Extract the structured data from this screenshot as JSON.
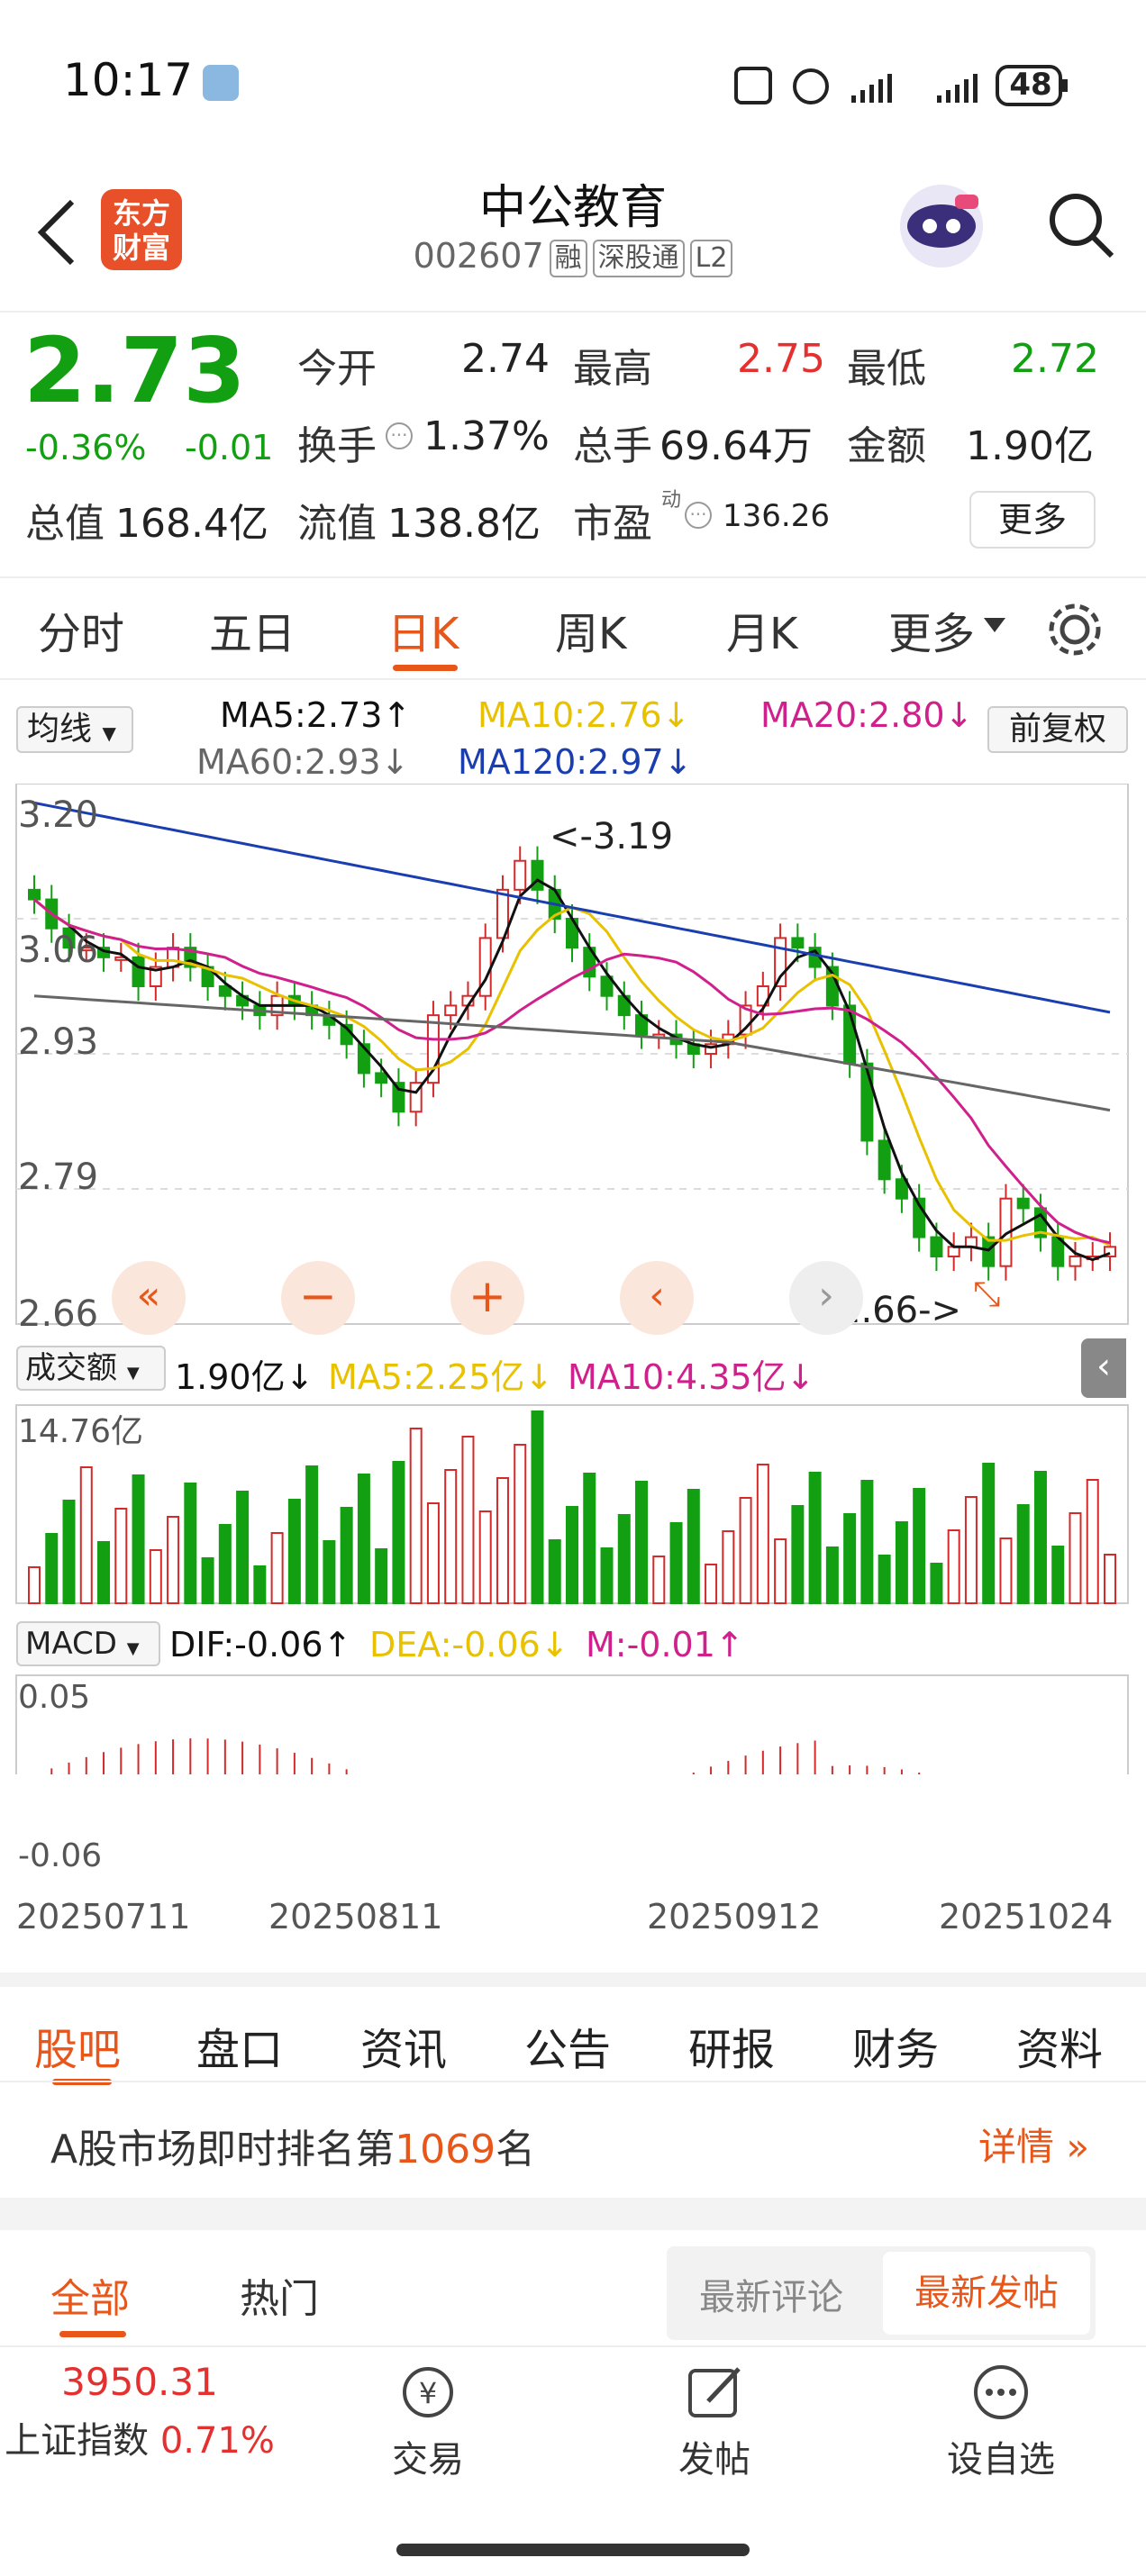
{
  "status_bar": {
    "time": "10:17",
    "battery": "48"
  },
  "header": {
    "title": "中公教育",
    "code": "002607",
    "tags": [
      "融",
      "深股通",
      "L2"
    ],
    "logo_text": [
      "东方",
      "财富"
    ]
  },
  "quote": {
    "price": "2.73",
    "change_pct": "-0.36%",
    "change": "-0.01",
    "open_label": "今开",
    "open": "2.74",
    "high_label": "最高",
    "high": "2.75",
    "low_label": "最低",
    "low": "2.72",
    "turnover_label": "换手",
    "turnover": "1.37%",
    "volume_label": "总手",
    "volume": "69.64万",
    "amount_label": "金额",
    "amount": "1.90亿",
    "total_cap_label": "总值",
    "total_cap": "168.4亿",
    "float_cap_label": "流值",
    "float_cap": "138.8亿",
    "pe_label": "市盈",
    "pe_sup": "动",
    "pe": "136.26",
    "more_button": "更多"
  },
  "tabs": [
    "分时",
    "五日",
    "日K",
    "周K",
    "月K",
    "更多"
  ],
  "active_tab": 2,
  "indicators": {
    "ma_select": "均线",
    "ma5": "MA5:2.73↑",
    "ma10": "MA10:2.76↓",
    "ma20": "MA20:2.80↓",
    "ma60": "MA60:2.93↓",
    "ma120": "MA120:2.97↓",
    "adjust": "前复权",
    "vol_select": "成交额",
    "vol": "1.90亿↓",
    "vol_ma5": "MA5:2.25亿↓",
    "vol_ma10": "MA10:4.35亿↓",
    "macd_select": "MACD",
    "dif": "DIF:-0.06↑",
    "dea": "DEA:-0.06↓",
    "m": "M:-0.01↑"
  },
  "chart_data": {
    "type": "candlestick",
    "y_labels": [
      "3.20",
      "3.06",
      "2.93",
      "2.79",
      "2.66"
    ],
    "ylim": [
      2.65,
      3.21
    ],
    "high_marker": "<-3.19",
    "low_marker": "2.66->",
    "vol_label": "14.76亿",
    "macd_labels": [
      "0.05",
      "-0.06"
    ],
    "x_labels": [
      "20250711",
      "20250811",
      "20250912",
      "20251024"
    ],
    "colors": {
      "up": "#d42a2a",
      "down": "#12a012",
      "ma5": "#111111",
      "ma10": "#e8c100",
      "ma20": "#d0208c",
      "ma60": "#666666",
      "ma120": "#1a3eb0"
    }
  },
  "sub_tabs": [
    "股吧",
    "盘口",
    "资讯",
    "公告",
    "研报",
    "财务",
    "资料"
  ],
  "rank": {
    "prefix": "A股市场即时排名第",
    "number": "1069",
    "suffix": "名",
    "detail": "详情"
  },
  "feed_tabs": {
    "all": "全部",
    "hot": "热门",
    "latest_comment": "最新评论",
    "latest_post": "最新发帖"
  },
  "bottom_bar": {
    "index_value": "3950.31",
    "index_name": "上证指数",
    "index_pct": "0.71%",
    "trade": "交易",
    "post": "发帖",
    "watchlist": "设自选"
  }
}
